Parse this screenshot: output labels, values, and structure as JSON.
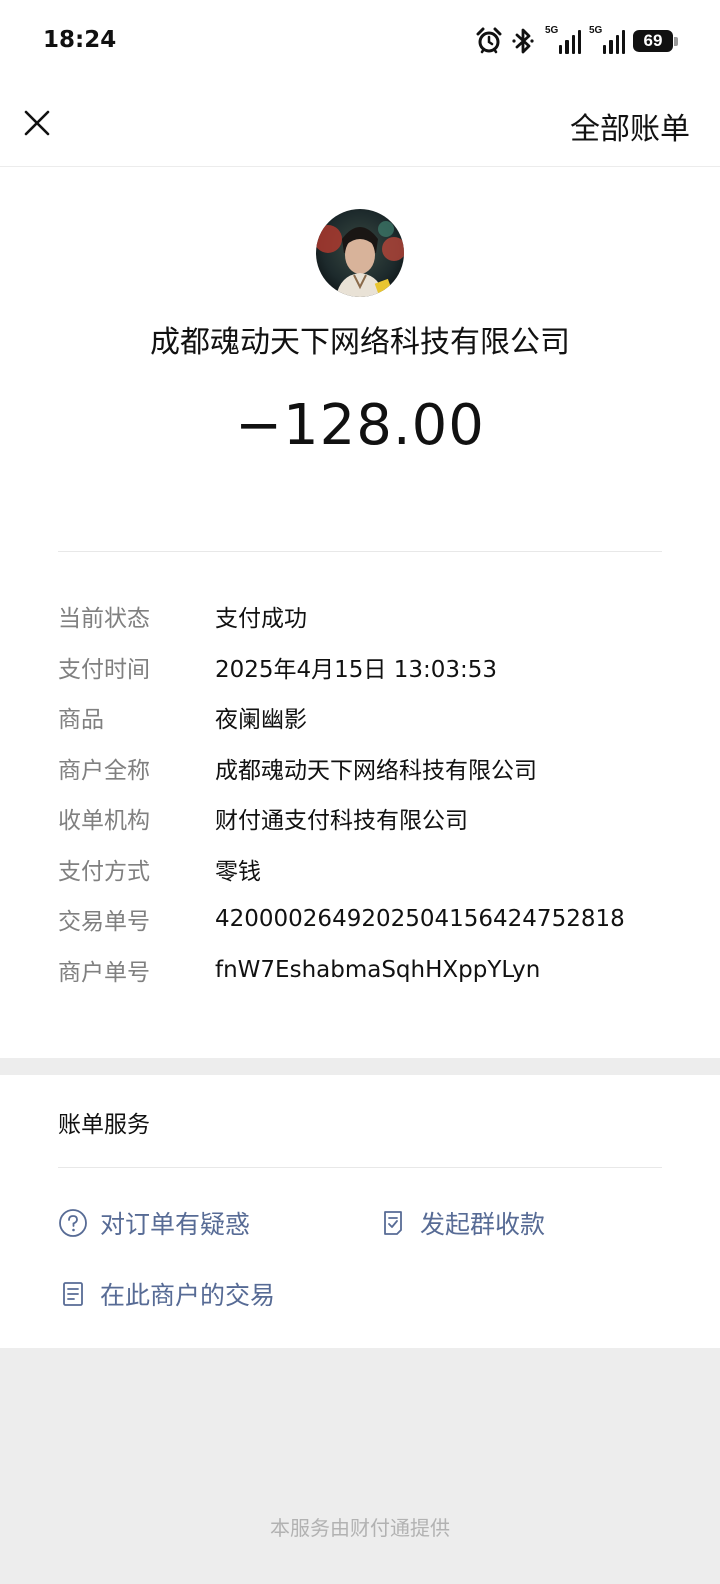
{
  "status_bar": {
    "time": "18:24",
    "icons": [
      "alarm-icon",
      "bluetooth-icon",
      "signal-5g-icon",
      "signal-5g-icon",
      "battery-icon"
    ],
    "signal_tag": "5G",
    "battery_level": "69"
  },
  "nav": {
    "close_icon": "close-icon",
    "all_bills_label": "全部账单"
  },
  "transaction": {
    "merchant_name": "成都魂动天下网络科技有限公司",
    "amount": "−128.00"
  },
  "details": [
    {
      "label": "当前状态",
      "value": "支付成功"
    },
    {
      "label": "支付时间",
      "value": "2025年4月15日 13:03:53"
    },
    {
      "label": "商品",
      "value": "夜阑幽影"
    },
    {
      "label": "商户全称",
      "value": "成都魂动天下网络科技有限公司"
    },
    {
      "label": "收单机构",
      "value": "财付通支付科技有限公司"
    },
    {
      "label": "支付方式",
      "value": "零钱"
    },
    {
      "label": "交易单号",
      "value": "4200002649202504156424752818"
    },
    {
      "label": "商户单号",
      "value": "fnW7EshabmaSqhHXppYLyn"
    }
  ],
  "services": {
    "title": "账单服务",
    "items": [
      {
        "label": "对订单有疑惑",
        "icon": "question-circle-icon"
      },
      {
        "label": "发起群收款",
        "icon": "checklist-icon"
      },
      {
        "label": "在此商户的交易",
        "icon": "document-icon"
      }
    ]
  },
  "footer": {
    "note": "本服务由财付通提供"
  },
  "colors": {
    "link": "#576b95",
    "label_gray": "#808080",
    "background": "#ededed"
  }
}
